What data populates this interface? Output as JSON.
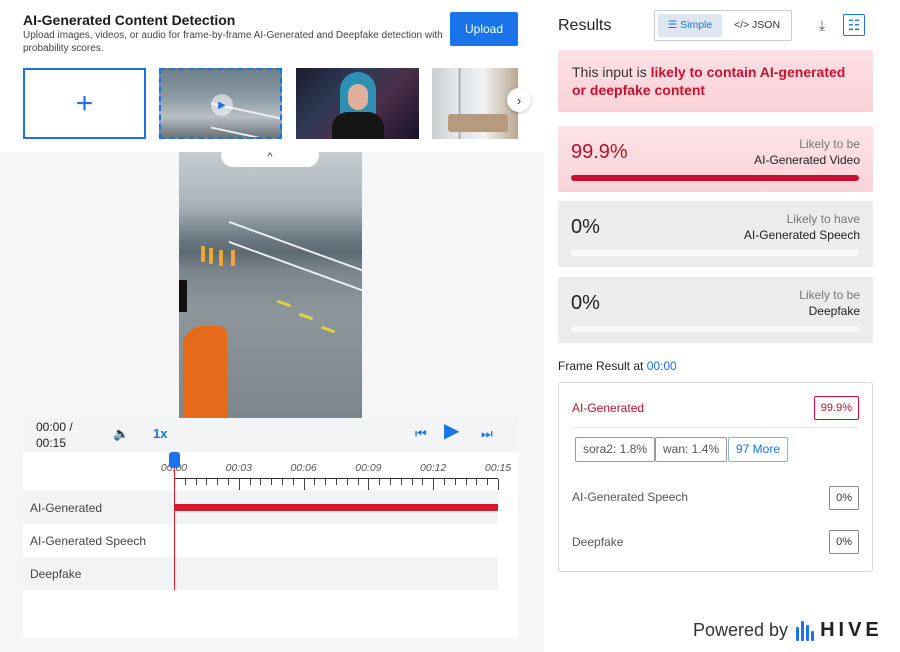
{
  "header": {
    "title": "AI-Generated Content Detection",
    "subtitle": "Upload images, videos, or audio for frame-by-frame AI-Generated and Deepfake detection with probability scores.",
    "upload_label": "Upload"
  },
  "gallery": {
    "add_symbol": "+",
    "thumbnails": [
      "ship-deck-video",
      "blue-hair-portrait",
      "living-room-interior"
    ],
    "selected_index": 0,
    "next_symbol": "›",
    "collapse_symbol": "^"
  },
  "player": {
    "time_current": "00:00 /",
    "time_total": "00:15",
    "speed_label": "1x",
    "icons": [
      "volume-icon",
      "skip-back-icon",
      "play-icon",
      "skip-forward-icon"
    ],
    "timeline_labels": [
      "00:00",
      "00:03",
      "00:06",
      "00:09",
      "00:12",
      "00:15"
    ],
    "tracks": [
      {
        "label": "AI-Generated",
        "flagged": true
      },
      {
        "label": "AI-Generated Speech",
        "flagged": false
      },
      {
        "label": "Deepfake",
        "flagged": false
      }
    ]
  },
  "results": {
    "title": "Results",
    "view_simple": "Simple",
    "view_json": "</> JSON",
    "verdict_prefix": "This input is ",
    "verdict_strong": "likely to contain AI-generated or deepfake content",
    "cards": [
      {
        "pct": "99.9%",
        "fill": 0.999,
        "line1": "Likely to be",
        "line2": "AI-Generated Video"
      },
      {
        "pct": "0%",
        "fill": 0,
        "line1": "Likely to have",
        "line2": "AI-Generated Speech"
      },
      {
        "pct": "0%",
        "fill": 0,
        "line1": "Likely to be",
        "line2": "Deepfake"
      }
    ],
    "frame_title_prefix": "Frame Result at ",
    "frame_time": "00:00",
    "frame": {
      "ai_label": "AI-Generated",
      "ai_value": "99.9%",
      "chips": [
        "sora2: 1.8%",
        "wan: 1.4%"
      ],
      "more_label": "97 More",
      "speech_label": "AI-Generated Speech",
      "speech_value": "0%",
      "deepfake_label": "Deepfake",
      "deepfake_value": "0%"
    },
    "powered_by": "Powered by",
    "brand": "HIVE"
  },
  "colors": {
    "accent": "#1a73e8",
    "danger": "#c8102e",
    "verdict_bg": "#fbd8de"
  }
}
